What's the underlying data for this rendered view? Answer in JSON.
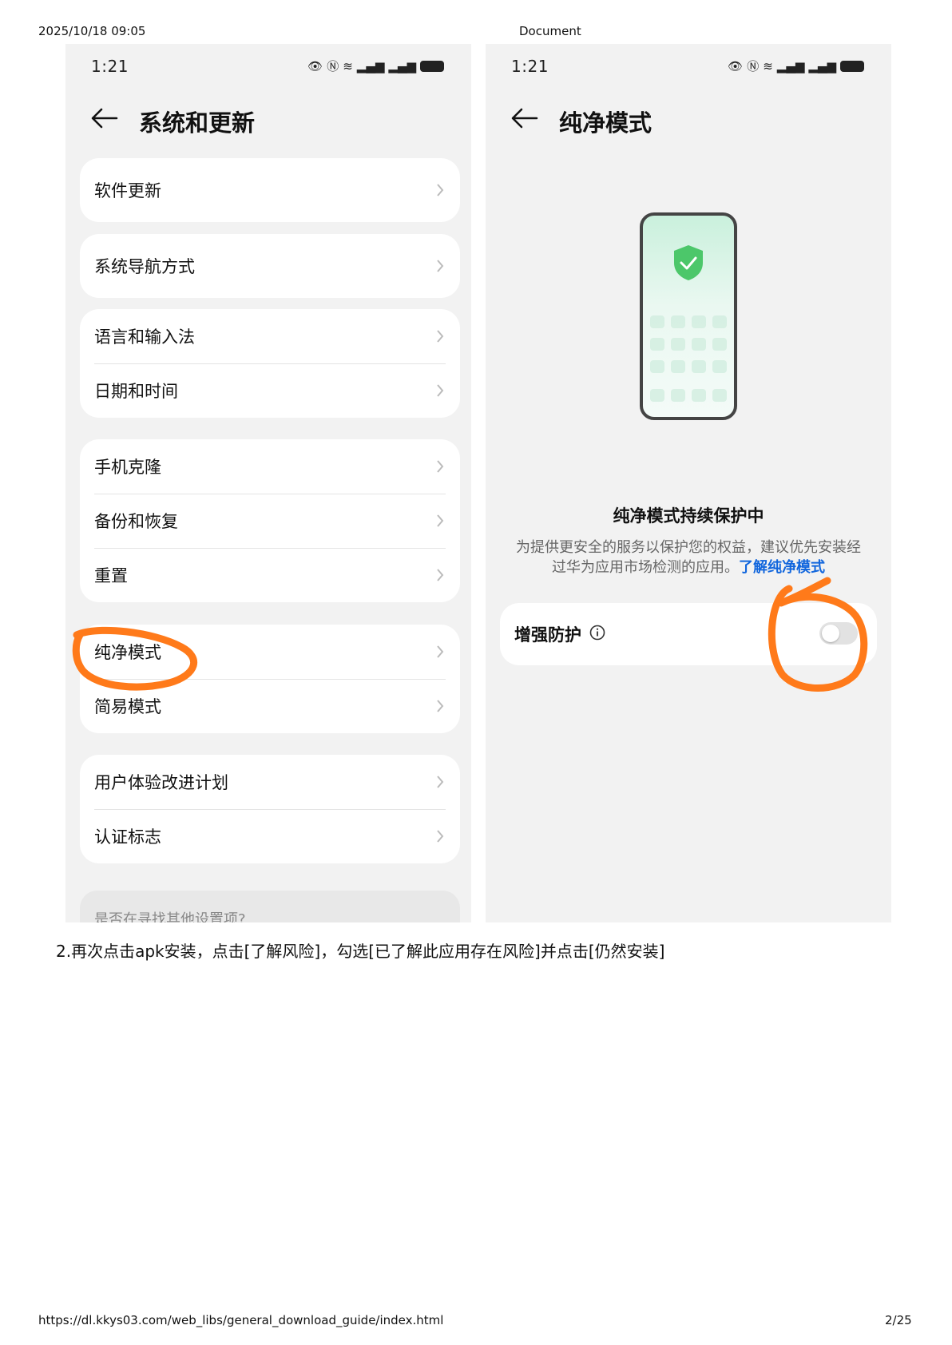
{
  "page": {
    "datetime": "2025/10/18 09:05",
    "doc_title": "Document",
    "url": "https://dl.kkys03.com/web_libs/general_download_guide/index.html",
    "page_number": "2/25"
  },
  "left_screen": {
    "status_time": "1:21",
    "title": "系统和更新",
    "groups": [
      [
        "软件更新"
      ],
      [
        "系统导航方式"
      ],
      [
        "语言和输入法",
        "日期和时间"
      ],
      [
        "手机克隆",
        "备份和恢复",
        "重置"
      ],
      [
        "纯净模式",
        "简易模式"
      ],
      [
        "用户体验改进计划",
        "认证标志"
      ]
    ],
    "search_hint": "是否在寻找其他设置项?"
  },
  "right_screen": {
    "status_time": "1:21",
    "title": "纯净模式",
    "status_title": "纯净模式持续保护中",
    "status_desc": "为提供更安全的服务以保护您的权益，建议优先安装经过华为应用市场检测的应用。",
    "learn_more_link": "了解纯净模式",
    "toggle_label": "增强防护",
    "toggle_on": false
  },
  "caption": "2.再次点击apk安装，点击[了解风险]，勾选[已了解此应用存在风险]并点击[仍然安装]",
  "colors": {
    "annotation": "#ff7a1a",
    "link": "#1166dd",
    "shield": "#4cc76a"
  }
}
